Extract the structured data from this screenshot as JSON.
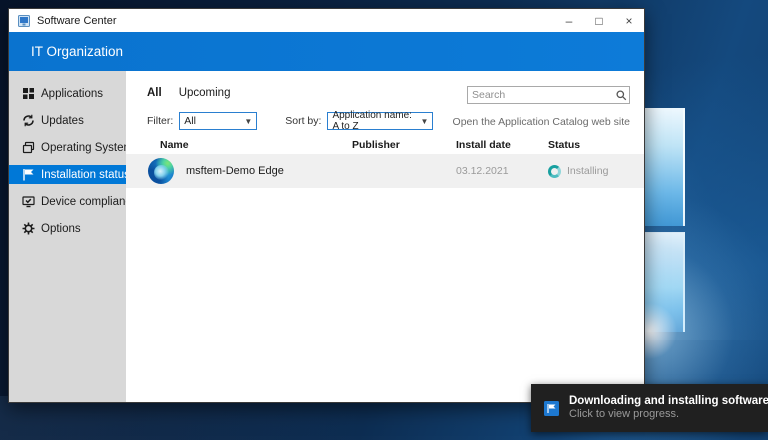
{
  "window": {
    "title": "Software Center",
    "controls": {
      "minimize": "–",
      "maximize": "□",
      "close": "×"
    }
  },
  "banner": {
    "org_name": "IT Organization"
  },
  "sidebar": {
    "items": [
      {
        "label": "Applications",
        "icon": "applications-icon",
        "selected": false
      },
      {
        "label": "Updates",
        "icon": "updates-icon",
        "selected": false
      },
      {
        "label": "Operating Systems",
        "icon": "operating-systems-icon",
        "selected": false
      },
      {
        "label": "Installation status",
        "icon": "installation-status-icon",
        "selected": true
      },
      {
        "label": "Device compliance",
        "icon": "device-compliance-icon",
        "selected": false
      },
      {
        "label": "Options",
        "icon": "options-icon",
        "selected": false
      }
    ]
  },
  "tabs": [
    {
      "label": "All",
      "selected": true
    },
    {
      "label": "Upcoming",
      "selected": false
    }
  ],
  "search": {
    "placeholder": "Search"
  },
  "filter": {
    "label": "Filter:",
    "value": "All"
  },
  "sort": {
    "label": "Sort by:",
    "value": "Application name: A to Z"
  },
  "catalog_link": "Open the Application Catalog web site",
  "table": {
    "columns": [
      "Name",
      "Publisher",
      "Install date",
      "Status"
    ],
    "rows": [
      {
        "name": "msftem-Demo Edge",
        "publisher": "",
        "install_date": "03.12.2021",
        "status": "Installing"
      }
    ]
  },
  "toast": {
    "title": "Downloading and installing software",
    "subtitle": "Click to view progress."
  },
  "colors": {
    "accent": "#0078d7",
    "sidebar_bg": "#d8d8d8",
    "row_bg": "#f0f0f0",
    "toast_bg": "#202020",
    "spinner": "#18a0a0"
  }
}
